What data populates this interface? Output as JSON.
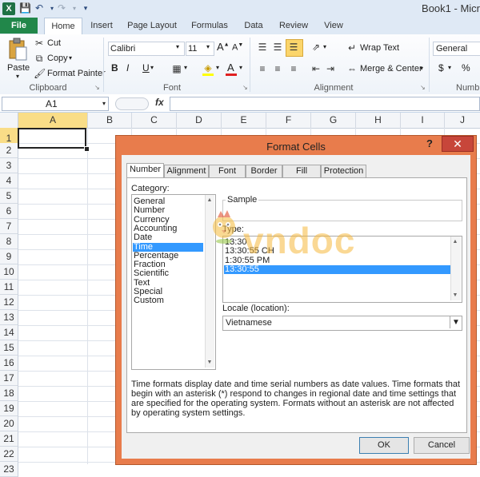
{
  "window": {
    "title": "Book1 - Micr"
  },
  "tabs": [
    "File",
    "Home",
    "Insert",
    "Page Layout",
    "Formulas",
    "Data",
    "Review",
    "View"
  ],
  "ribbon": {
    "paste": "Paste",
    "cut": "Cut",
    "copy": "Copy",
    "format_painter": "Format Painter",
    "clipboard": "Clipboard",
    "font_name": "Calibri",
    "font_size": "11",
    "font_label": "Font",
    "bold": "B",
    "italic": "I",
    "underline": "U",
    "wrap_text": "Wrap Text",
    "merge_center": "Merge & Center",
    "alignment": "Alignment",
    "number_format": "General",
    "number_label": "Numb",
    "dollar": "$",
    "percent": "%"
  },
  "formula_bar": {
    "name_box": "A1",
    "fx": "fx"
  },
  "columns": [
    "A",
    "B",
    "C",
    "D",
    "E",
    "F",
    "G",
    "H",
    "I",
    "J"
  ],
  "rows": [
    "1",
    "2",
    "3",
    "4",
    "5",
    "6",
    "7",
    "8",
    "9",
    "10",
    "11",
    "12",
    "13",
    "14",
    "15",
    "16",
    "17",
    "18",
    "19",
    "20",
    "21",
    "22",
    "23"
  ],
  "dialog": {
    "title": "Format Cells",
    "help": "?",
    "tabs": [
      "Number",
      "Alignment",
      "Font",
      "Border",
      "Fill",
      "Protection"
    ],
    "category_label": "Category:",
    "categories": [
      "General",
      "Number",
      "Currency",
      "Accounting",
      "Date",
      "Time",
      "Percentage",
      "Fraction",
      "Scientific",
      "Text",
      "Special",
      "Custom"
    ],
    "selected_category": "Time",
    "sample_label": "Sample",
    "type_label": "Type:",
    "types": [
      "13:30",
      "13:30:55 CH",
      "1:30:55 PM",
      "13:30:55"
    ],
    "selected_type": "13:30:55",
    "locale_label": "Locale (location):",
    "locale_value": "Vietnamese",
    "description": "Time formats display date and time serial numbers as date values.  Time formats that begin with an asterisk (*) respond to changes in regional date and time settings that are specified for the operating system. Formats without an asterisk are not affected by operating system settings.",
    "ok": "OK",
    "cancel": "Cancel"
  },
  "watermark": "vndoc",
  "colors": {
    "dialog_border": "#e87c4c",
    "selection": "#3399ff",
    "file_tab": "#21874a"
  }
}
